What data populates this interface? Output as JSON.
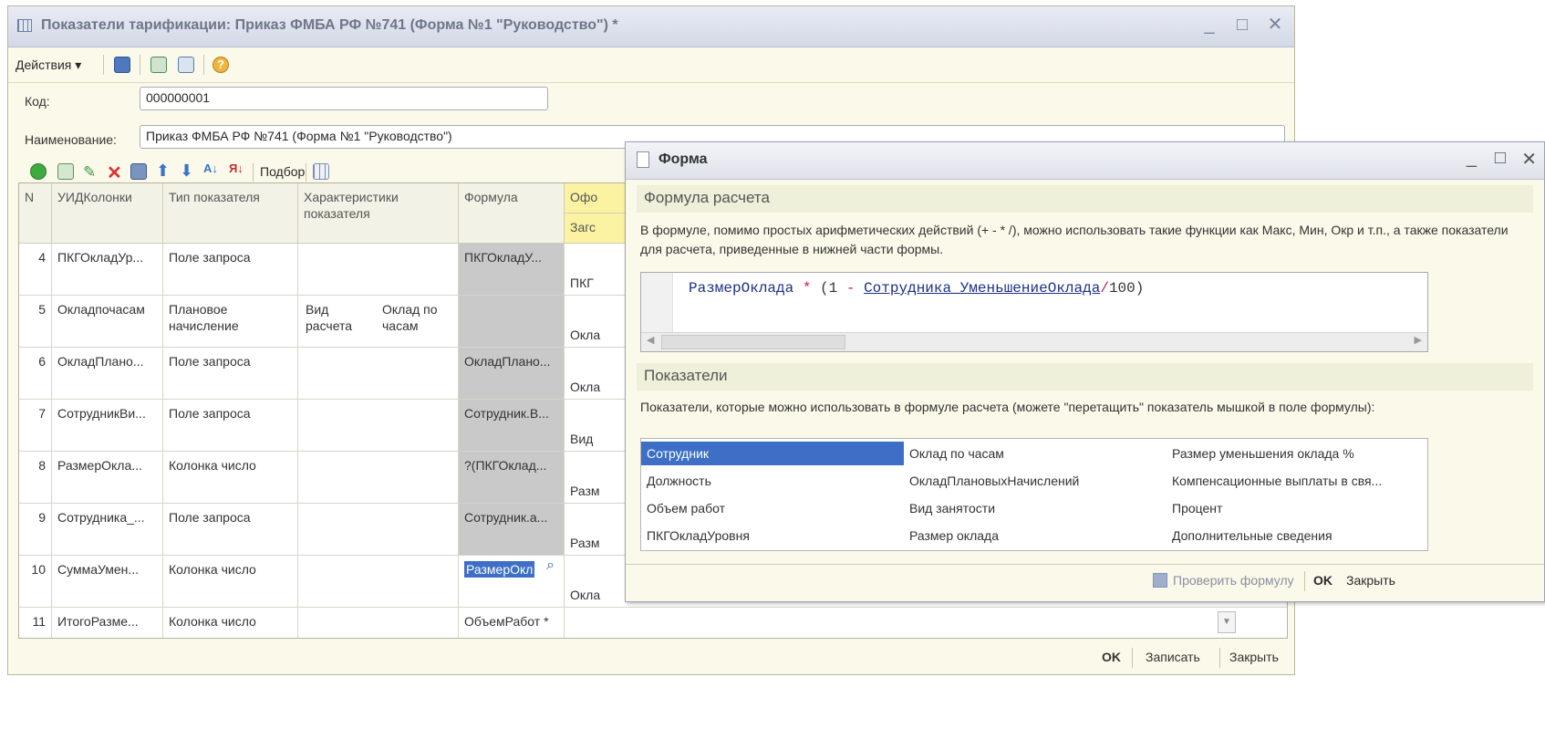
{
  "window": {
    "title": "Показатели тарификации: Приказ ФМБА РФ №741 (Форма №1 \"Руководство\") *",
    "controls": [
      "_",
      "□",
      "✕"
    ]
  },
  "toolbar": {
    "actions_label": "Действия ▾"
  },
  "fields": {
    "code_label": "Код:",
    "code_value": "000000001",
    "name_label": "Наименование:",
    "name_value": "Приказ ФМБА РФ №741 (Форма №1 \"Руководство\")"
  },
  "grid_toolbar": {
    "podbor_label": "Подбор"
  },
  "grid": {
    "headers": [
      "N",
      "УИДКолонки",
      "Тип показателя",
      "Характеристики показателя",
      "Формула",
      "Офо",
      "Загс"
    ],
    "rows": [
      {
        "n": "4",
        "uid": "ПКГОкладУр...",
        "type": "Поле запроса",
        "char_a": "",
        "char_b": "",
        "formula": "ПКГОкладУ...",
        "extra": "ПКГ"
      },
      {
        "n": "5",
        "uid": "Окладпочасам",
        "type": "Плановое начисление",
        "char_a": "Вид расчета",
        "char_b": "Оклад по часам",
        "formula": "",
        "extra": "Окла"
      },
      {
        "n": "6",
        "uid": "ОкладПлано...",
        "type": "Поле запроса",
        "char_a": "",
        "char_b": "",
        "formula": "ОкладПлано...",
        "extra": "Окла"
      },
      {
        "n": "7",
        "uid": "СотрудникВи...",
        "type": "Поле запроса",
        "char_a": "",
        "char_b": "",
        "formula": "Сотрудник.В...",
        "extra": "Вид"
      },
      {
        "n": "8",
        "uid": "РазмерОкла...",
        "type": "Колонка число",
        "char_a": "",
        "char_b": "",
        "formula": "?(ПКГОклад...",
        "extra": "Разм"
      },
      {
        "n": "9",
        "uid": "Сотрудника_...",
        "type": "Поле запроса",
        "char_a": "",
        "char_b": "",
        "formula": "Сотрудник.а...",
        "extra": "Разм"
      },
      {
        "n": "10",
        "uid": "СуммаУмен...",
        "type": "Колонка число",
        "char_a": "",
        "char_b": "",
        "formula": "РазмерОкл",
        "extra": "Окла"
      },
      {
        "n": "11",
        "uid": "ИтогоРазме...",
        "type": "Колонка число",
        "char_a": "",
        "char_b": "",
        "formula": "ОбъемРабот *",
        "extra": ""
      }
    ]
  },
  "footer": {
    "ok": "OK",
    "save": "Записать",
    "close": "Закрыть"
  },
  "dialog": {
    "title": "Форма",
    "section1": "Формула расчета",
    "info1": "В формуле, помимо простых арифметических действий (+ - * /), можно использовать такие функции как Макс, Мин, Окр и т.п., а также показатели для расчета, приведенные в нижней части формы.",
    "formula": {
      "t1": "РазмерОклада",
      "t2": "*",
      "t3": "(1",
      "t4": "-",
      "t5": "Сотрудника_УменьшениеОклада",
      "t6": "/",
      "t7": "100)"
    },
    "section2": "Показатели",
    "info2": "Показатели, которые можно использовать в формуле расчета (можете \"перетащить\" показатель мышкой в поле формулы):",
    "indicators": [
      [
        "Сотрудник",
        "Оклад по часам",
        "Размер уменьшения оклада %"
      ],
      [
        "Должность",
        "ОкладПлановыхНачислений",
        "Компенсационные выплаты в свя..."
      ],
      [
        "Объем работ",
        "Вид занятости",
        "Процент"
      ],
      [
        "ПКГОкладУровня",
        "Размер оклада",
        "Дополнительные сведения"
      ]
    ],
    "check_formula": "Проверить формулу",
    "ok": "OK",
    "close": "Закрыть"
  },
  "colors": {
    "selection": "#3d6fc6",
    "gray_cell": "#c9c9c9",
    "window_bg": "#fbf9ea"
  }
}
